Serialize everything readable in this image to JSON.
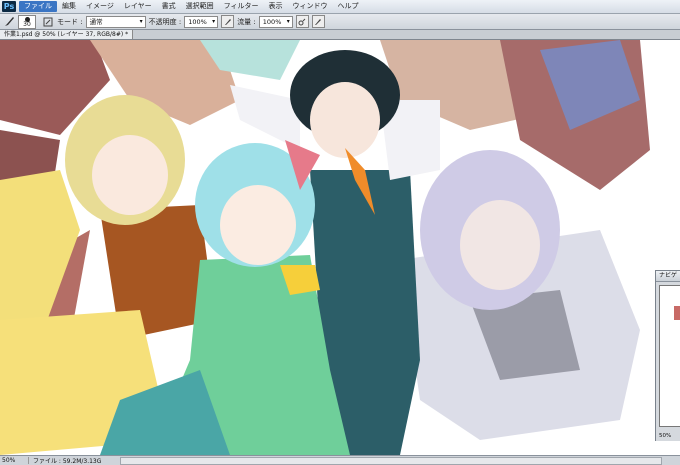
{
  "app": {
    "logo": "Ps"
  },
  "menu": {
    "items": [
      "ファイル",
      "編集",
      "イメージ",
      "レイヤー",
      "書式",
      "選択範囲",
      "フィルター",
      "表示",
      "ウィンドウ",
      "ヘルプ"
    ]
  },
  "options": {
    "brush_size": "30",
    "mode_label": "モード :",
    "mode_value": "通常",
    "opacity_label": "不透明度 :",
    "opacity_value": "100%",
    "flow_label": "流量 :",
    "flow_value": "100%"
  },
  "document": {
    "tab_title": "作業1.psd @ 50% (レイヤー 37, RGB/8#) *"
  },
  "navigator": {
    "title": "ナビゲ",
    "zoom": "50%"
  },
  "status": {
    "zoom": "50%",
    "info": "ファイル : 59.2M/3.13G"
  },
  "icons": [
    "brush-icon",
    "pressure-icon",
    "airbrush-icon",
    "chevron-down-icon"
  ],
  "colors": {
    "menubar": "#d6dde6",
    "active_menu": "#3a75c4",
    "panel": "#d5d9de"
  }
}
